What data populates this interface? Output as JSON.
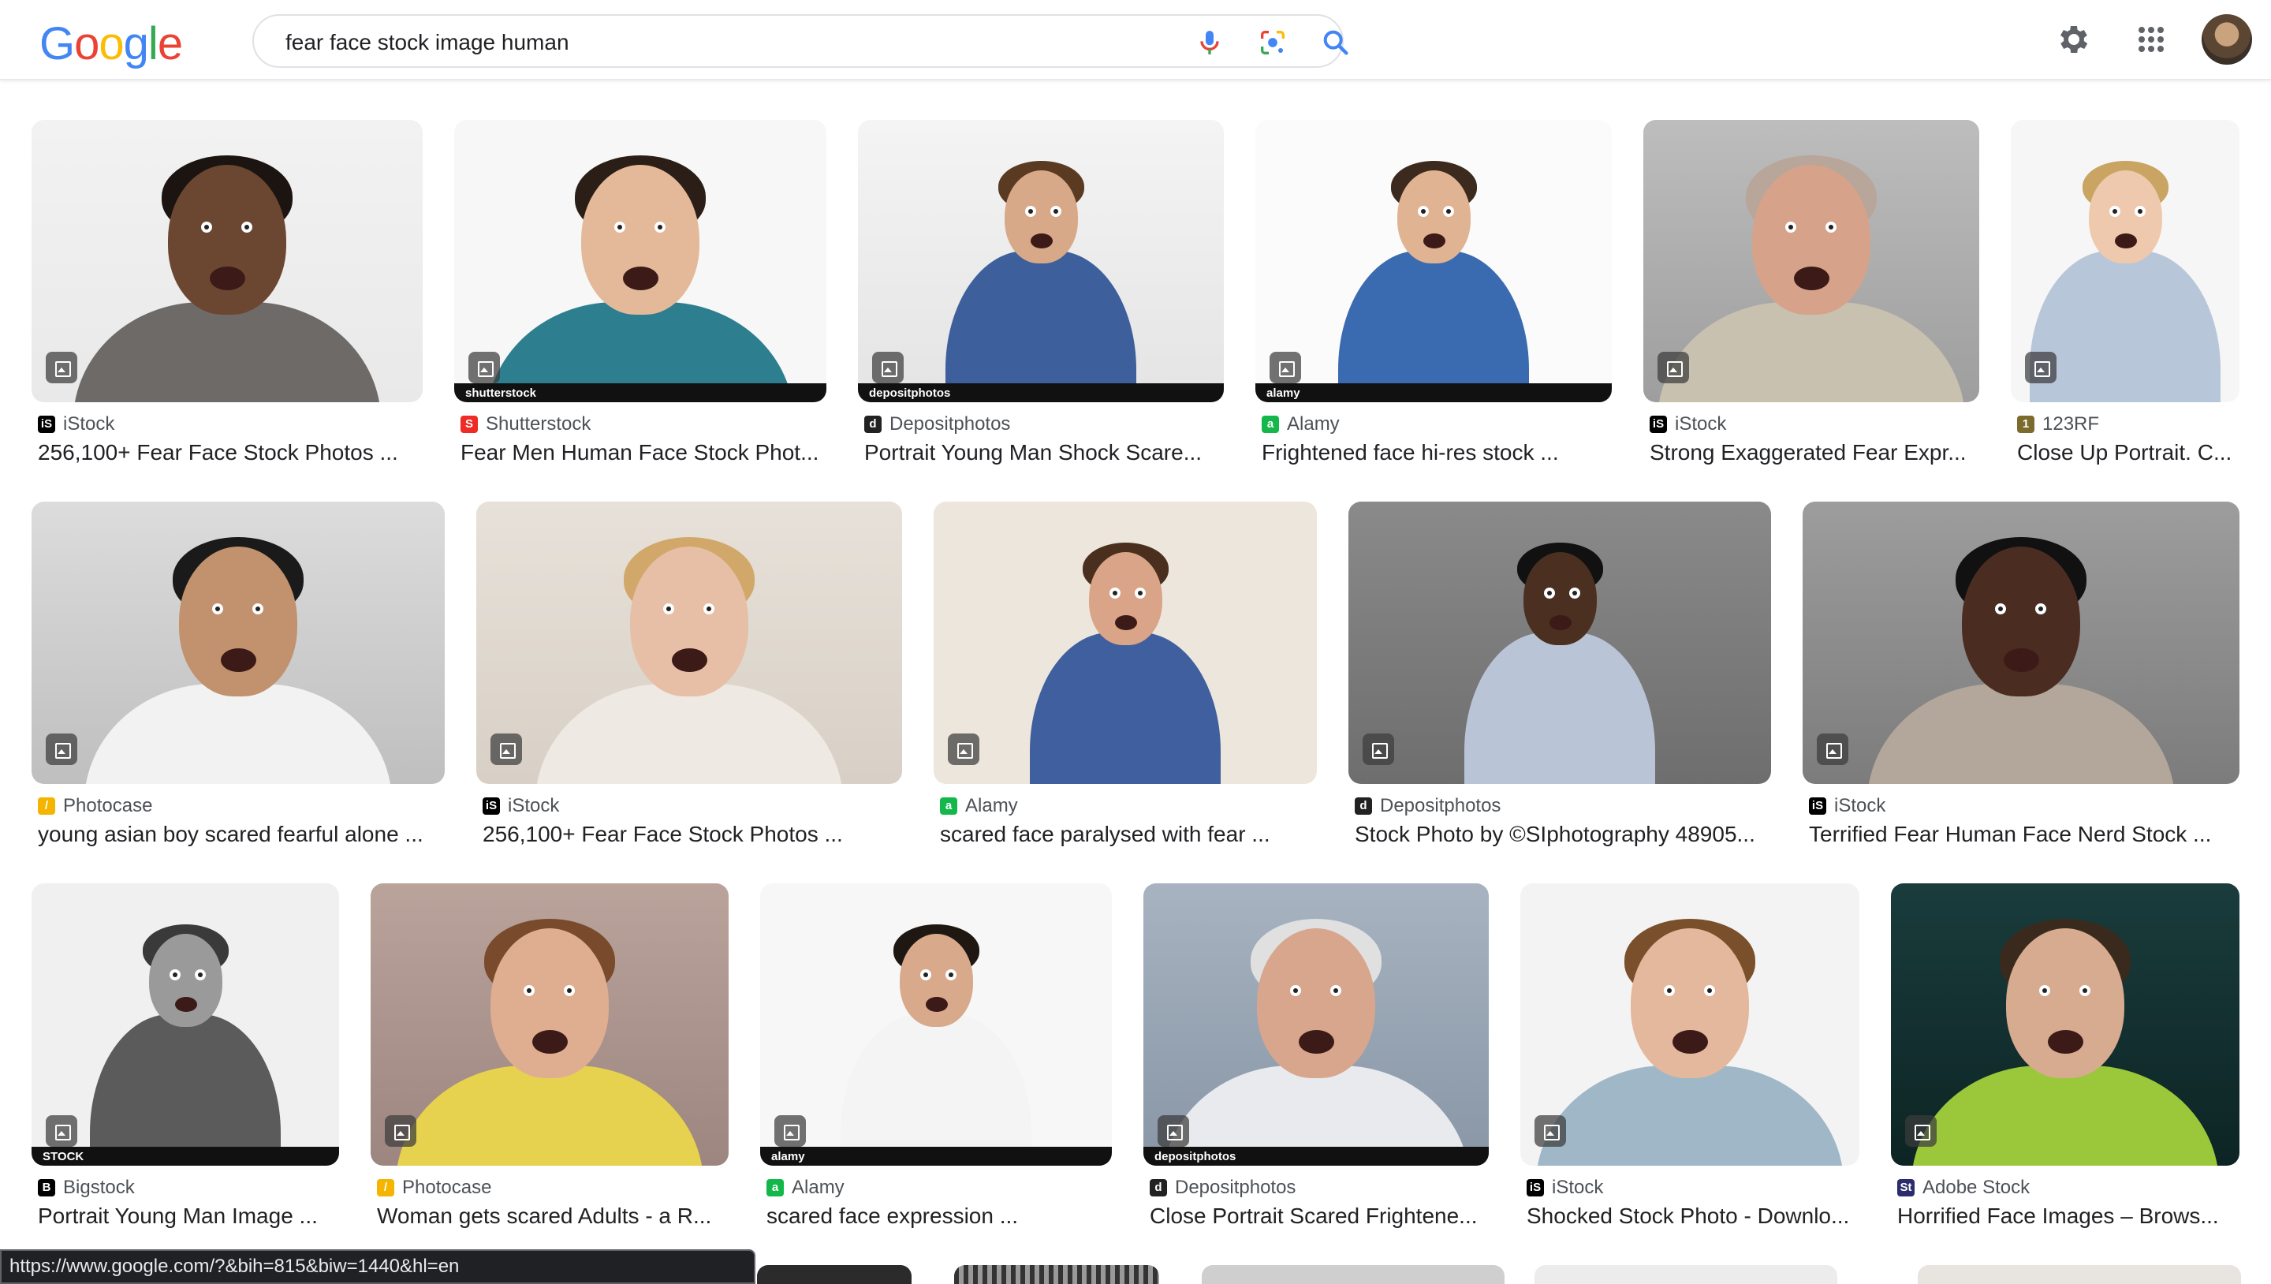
{
  "header": {
    "logo_letters": [
      "G",
      "o",
      "o",
      "g",
      "l",
      "e"
    ],
    "logo_colors": [
      "#4285F4",
      "#EA4335",
      "#FBBC05",
      "#4285F4",
      "#34A853",
      "#EA4335"
    ],
    "query": "fear face stock image human",
    "icons": [
      "mic-icon",
      "lens-icon",
      "search-icon",
      "settings-gear-icon",
      "apps-grid-icon",
      "account-avatar"
    ]
  },
  "results": [
    {
      "source": "iStock",
      "title": "256,100+ Fear Face Stock Photos ...",
      "favicon": "iS",
      "favicon_color": "#000000"
    },
    {
      "source": "Shutterstock",
      "title": "Fear Men Human Face Stock Phot...",
      "favicon": "S",
      "favicon_color": "#ee2b24"
    },
    {
      "source": "Depositphotos",
      "title": "Portrait Young Man Shock Scare...",
      "favicon": "d",
      "favicon_color": "#222222",
      "watermark": "depositphotos"
    },
    {
      "source": "Alamy",
      "title": "Frightened face hi-res stock ...",
      "favicon": "a",
      "favicon_color": "#14b84a",
      "watermark": "alamy"
    },
    {
      "source": "iStock",
      "title": "Strong Exaggerated Fear Expr...",
      "favicon": "iS",
      "favicon_color": "#000000"
    },
    {
      "source": "123RF",
      "title": "Close Up Portrait. C...",
      "favicon": "1",
      "favicon_color": "#7b6b2d"
    },
    {
      "source": "Photocase",
      "title": "young asian boy scared fearful alone ...",
      "favicon": "/",
      "favicon_color": "#f4b400"
    },
    {
      "source": "iStock",
      "title": "256,100+ Fear Face Stock Photos ...",
      "favicon": "iS",
      "favicon_color": "#000000"
    },
    {
      "source": "Alamy",
      "title": "scared face paralysed with fear ...",
      "favicon": "a",
      "favicon_color": "#14b84a"
    },
    {
      "source": "Depositphotos",
      "title": "Stock Photo by ©SIphotography 48905...",
      "favicon": "d",
      "favicon_color": "#222222"
    },
    {
      "source": "iStock",
      "title": "Terrified Fear Human Face Nerd Stock ...",
      "favicon": "iS",
      "favicon_color": "#000000"
    },
    {
      "source": "Bigstock",
      "title": "Portrait Young Man Image ...",
      "favicon": "B",
      "favicon_color": "#000000",
      "watermark": "STOCK"
    },
    {
      "source": "Photocase",
      "title": "Woman gets scared Adults - a R...",
      "favicon": "/",
      "favicon_color": "#f4b400"
    },
    {
      "source": "Alamy",
      "title": "scared face expression ...",
      "favicon": "a",
      "favicon_color": "#14b84a",
      "watermark": "alamy"
    },
    {
      "source": "Depositphotos",
      "title": "Close Portrait Scared Frightene...",
      "favicon": "d",
      "favicon_color": "#222222",
      "watermark": "depositphotos"
    },
    {
      "source": "iStock",
      "title": "Shocked Stock Photo - Downlo...",
      "favicon": "iS",
      "favicon_color": "#000000"
    },
    {
      "source": "Adobe Stock",
      "title": "Horrified Face Images – Brows...",
      "favicon": "St",
      "favicon_color": "#2c2c6c"
    }
  ],
  "shutterstock_watermark": "shutterstock",
  "status_bar": {
    "url": "https://www.google.com/?&bih=815&biw=1440&hl=en"
  }
}
